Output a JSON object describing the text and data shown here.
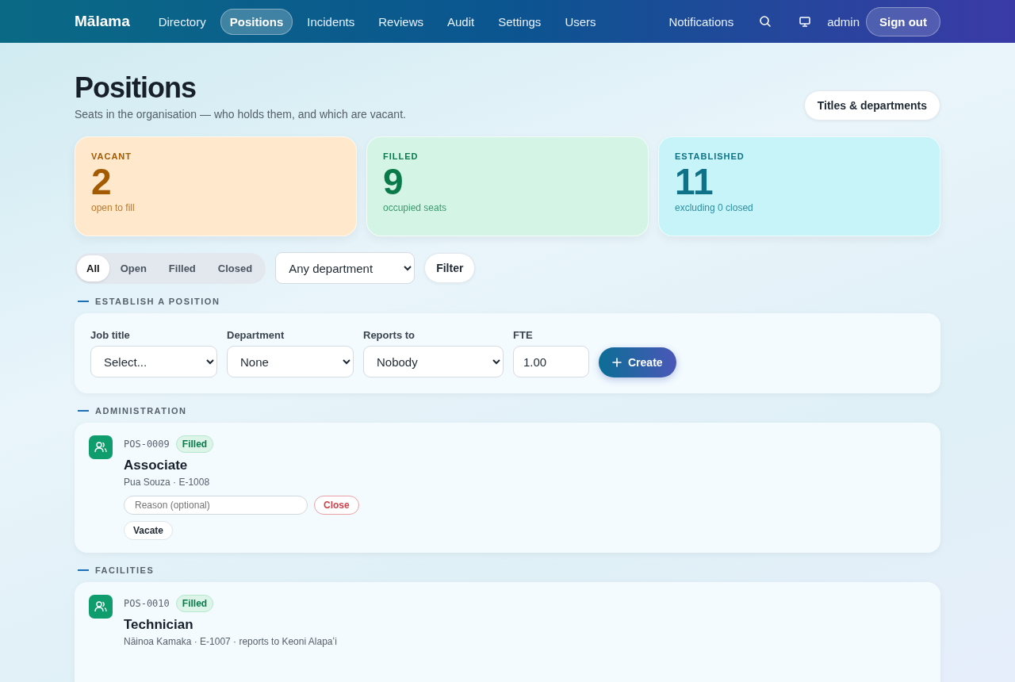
{
  "nav": {
    "brand": "Mālama",
    "links": [
      {
        "label": "Directory",
        "selected": false
      },
      {
        "label": "Positions",
        "selected": true
      },
      {
        "label": "Incidents",
        "selected": false
      },
      {
        "label": "Reviews",
        "selected": false
      },
      {
        "label": "Audit",
        "selected": false
      },
      {
        "label": "Settings",
        "selected": false
      },
      {
        "label": "Users",
        "selected": false
      }
    ],
    "notifications": "Notifications",
    "user": "admin",
    "sign_out": "Sign out"
  },
  "header": {
    "title": "Positions",
    "subtitle": "Seats in the organisation — who holds them, and which are vacant.",
    "action": "Titles & departments"
  },
  "stats": [
    {
      "kind": "vacant",
      "label": "VACANT",
      "value": "2",
      "note": "open to fill"
    },
    {
      "kind": "filled",
      "label": "FILLED",
      "value": "9",
      "note": "occupied seats"
    },
    {
      "kind": "established",
      "label": "ESTABLISHED",
      "value": "11",
      "note": "excluding 0 closed"
    }
  ],
  "filters": {
    "segments": [
      {
        "label": "All",
        "selected": true
      },
      {
        "label": "Open",
        "selected": false
      },
      {
        "label": "Filled",
        "selected": false
      },
      {
        "label": "Closed",
        "selected": false
      }
    ],
    "department": "Any department",
    "button": "Filter"
  },
  "create": {
    "heading": "ESTABLISH A POSITION",
    "fields": [
      {
        "kind": "select",
        "label": "Job title",
        "value": "Select..."
      },
      {
        "kind": "select",
        "label": "Department",
        "value": "None"
      },
      {
        "kind": "select",
        "label": "Reports to",
        "value": "Nobody"
      },
      {
        "kind": "input",
        "label": "FTE",
        "value": "1.00"
      }
    ],
    "button": "Create"
  },
  "groups": [
    {
      "heading": "ADMINISTRATION",
      "positions": [
        {
          "code": "POS-0009",
          "status": "Filled",
          "title": "Associate",
          "detail": "Pua Souza · E-1008",
          "reason_placeholder": "Reason (optional)",
          "close": "Close",
          "vacate": "Vacate"
        }
      ]
    },
    {
      "heading": "FACILITIES",
      "positions": [
        {
          "code": "POS-0010",
          "status": "Filled",
          "title": "Technician",
          "detail": "Nāinoa Kamaka · E-1007 · reports to Keoni Alapaʻi"
        }
      ]
    }
  ]
}
